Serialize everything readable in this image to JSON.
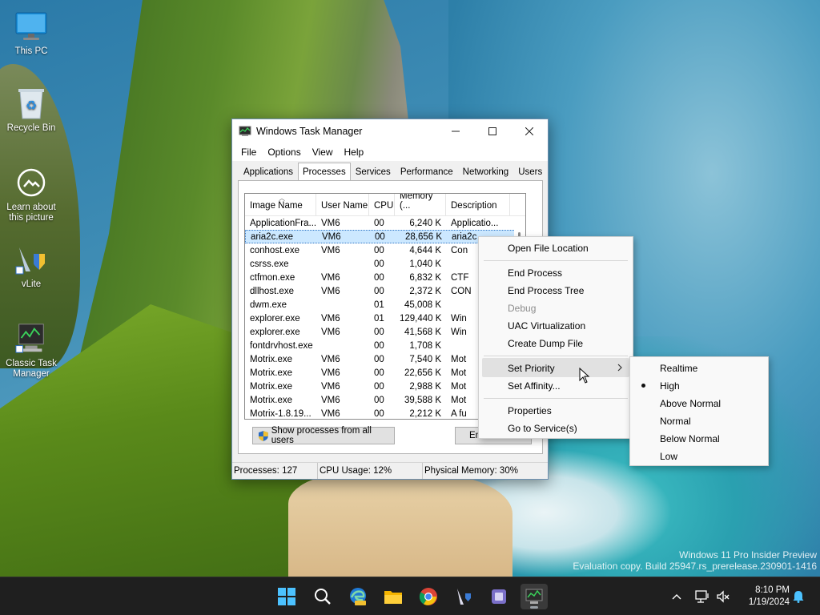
{
  "desktop": {
    "icons": [
      {
        "label": "This PC",
        "icon": "monitor-icon"
      },
      {
        "label": "Recycle Bin",
        "icon": "recycle-bin-icon"
      },
      {
        "label": "Learn about this picture",
        "icon": "camera-info-icon"
      },
      {
        "label": "vLite",
        "icon": "vlite-icon"
      },
      {
        "label": "Classic Task Manager",
        "icon": "task-manager-icon"
      }
    ],
    "watermark_line1": "Windows 11 Pro Insider Preview",
    "watermark_line2": "Evaluation copy. Build 25947.rs_prerelease.230901-1416"
  },
  "window": {
    "title": "Windows Task Manager",
    "menu": [
      "File",
      "Options",
      "View",
      "Help"
    ],
    "tabs": [
      "Applications",
      "Processes",
      "Services",
      "Performance",
      "Networking",
      "Users"
    ],
    "active_tab": "Processes",
    "columns": [
      "Image Name",
      "User Name",
      "CPU",
      "Memory (...",
      "Description"
    ],
    "rows": [
      [
        "ApplicationFra...",
        "VM6",
        "00",
        "6,240 K",
        "Applicatio..."
      ],
      [
        "aria2c.exe",
        "VM6",
        "00",
        "28,656 K",
        "aria2c"
      ],
      [
        "conhost.exe",
        "VM6",
        "00",
        "4,644 K",
        "Con"
      ],
      [
        "csrss.exe",
        "",
        "00",
        "1,040 K",
        ""
      ],
      [
        "ctfmon.exe",
        "VM6",
        "00",
        "6,832 K",
        "CTF"
      ],
      [
        "dllhost.exe",
        "VM6",
        "00",
        "2,372 K",
        "CON"
      ],
      [
        "dwm.exe",
        "",
        "01",
        "45,008 K",
        ""
      ],
      [
        "explorer.exe",
        "VM6",
        "01",
        "129,440 K",
        "Win"
      ],
      [
        "explorer.exe",
        "VM6",
        "00",
        "41,568 K",
        "Win"
      ],
      [
        "fontdrvhost.exe",
        "",
        "00",
        "1,708 K",
        ""
      ],
      [
        "Motrix.exe",
        "VM6",
        "00",
        "7,540 K",
        "Mot"
      ],
      [
        "Motrix.exe",
        "VM6",
        "00",
        "22,656 K",
        "Mot"
      ],
      [
        "Motrix.exe",
        "VM6",
        "00",
        "2,988 K",
        "Mot"
      ],
      [
        "Motrix.exe",
        "VM6",
        "00",
        "39,588 K",
        "Mot"
      ],
      [
        "Motrix-1.8.19...",
        "VM6",
        "00",
        "2,212 K",
        "A fu"
      ]
    ],
    "selected_row": 1,
    "show_all_label": "Show processes from all users",
    "end_process_label": "En",
    "status": {
      "processes": "Processes: 127",
      "cpu": "CPU Usage: 12%",
      "memory": "Physical Memory: 30%"
    }
  },
  "context_menu": {
    "items": [
      {
        "label": "Open File Location",
        "enabled": true
      },
      {
        "label": "End Process",
        "enabled": true
      },
      {
        "label": "End Process Tree",
        "enabled": true
      },
      {
        "label": "Debug",
        "enabled": false
      },
      {
        "label": "UAC Virtualization",
        "enabled": true
      },
      {
        "label": "Create Dump File",
        "enabled": true
      },
      {
        "label": "Set Priority",
        "enabled": true,
        "submenu": true,
        "highlighted": true
      },
      {
        "label": "Set Affinity...",
        "enabled": true
      },
      {
        "label": "Properties",
        "enabled": true
      },
      {
        "label": "Go to Service(s)",
        "enabled": true
      }
    ]
  },
  "priority_submenu": {
    "items": [
      "Realtime",
      "High",
      "Above Normal",
      "Normal",
      "Below Normal",
      "Low"
    ],
    "checked": "High"
  },
  "taskbar": {
    "apps": [
      "start-icon",
      "search-icon",
      "edge-beta-icon",
      "file-explorer-icon",
      "chrome-icon",
      "vlite-icon",
      "app-icon",
      "task-manager-icon"
    ],
    "time": "8:10 PM",
    "date": "1/19/2024"
  },
  "colors": {
    "selection": "#cce8ff",
    "taskbar": "#1f1f1f",
    "accent": "#0067c0"
  }
}
